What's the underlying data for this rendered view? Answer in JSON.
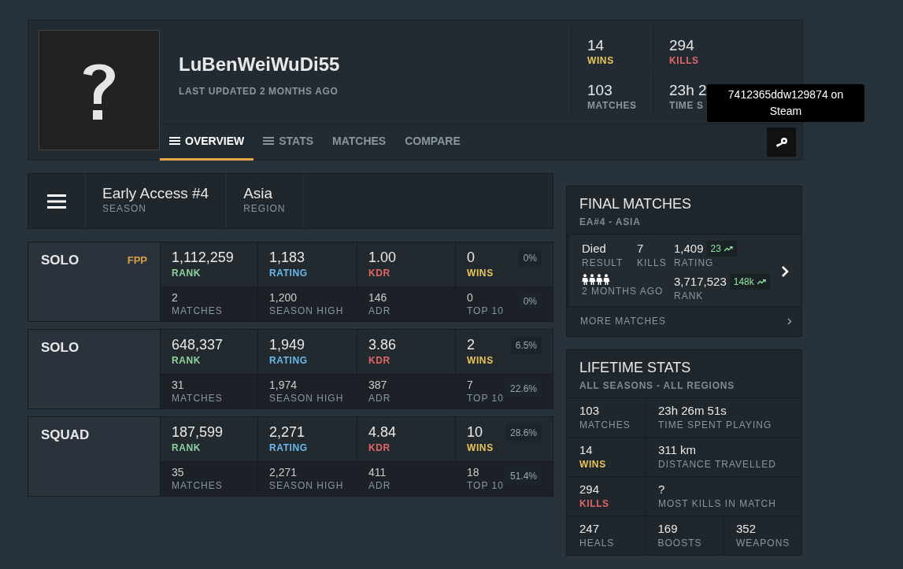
{
  "profile": {
    "name": "LuBenWeiWuDi55",
    "updated": "LAST UPDATED 2 MONTHS AGO"
  },
  "header_stats": [
    {
      "value": "14",
      "label": "WINS",
      "kind": "wins"
    },
    {
      "value": "294",
      "label": "KILLS",
      "kind": "kills"
    },
    {
      "value": "103",
      "label": "MATCHES",
      "kind": "plain"
    },
    {
      "value": "23h 2",
      "label": "TIME S",
      "kind": "plain"
    }
  ],
  "tabs": [
    {
      "label": "OVERVIEW",
      "selected": true,
      "menu_icon": true
    },
    {
      "label": "STATS",
      "selected": false,
      "menu_icon": true
    },
    {
      "label": "MATCHES",
      "selected": false,
      "menu_icon": false
    },
    {
      "label": "COMPARE",
      "selected": false,
      "menu_icon": false
    }
  ],
  "tooltip": "7412365ddw129874 on Steam",
  "season_bar": [
    {
      "value": "Early Access #4",
      "label": "SEASON"
    },
    {
      "value": "Asia",
      "label": "REGION"
    }
  ],
  "modes": [
    {
      "mode": "SOLO",
      "perspective": "FPP",
      "cells": [
        {
          "value": "1,112,259",
          "label": "RANK",
          "kind": "rank"
        },
        {
          "value": "1,183",
          "label": "RATING",
          "kind": "rating"
        },
        {
          "value": "1.00",
          "label": "KDR",
          "kind": "kdr"
        },
        {
          "value": "0",
          "label": "WINS",
          "kind": "wins",
          "percent": "0%"
        },
        {
          "value": "2",
          "label": "MATCHES",
          "kind": "plain"
        },
        {
          "value": "1,200",
          "label": "SEASON HIGH",
          "kind": "plain"
        },
        {
          "value": "146",
          "label": "ADR",
          "kind": "plain"
        },
        {
          "value": "0",
          "label": "TOP 10",
          "kind": "plain",
          "percent": "0%"
        }
      ]
    },
    {
      "mode": "SOLO",
      "cells": [
        {
          "value": "648,337",
          "label": "RANK",
          "kind": "rank"
        },
        {
          "value": "1,949",
          "label": "RATING",
          "kind": "rating"
        },
        {
          "value": "3.86",
          "label": "KDR",
          "kind": "kdr"
        },
        {
          "value": "2",
          "label": "WINS",
          "kind": "wins",
          "percent": "6.5%"
        },
        {
          "value": "31",
          "label": "MATCHES",
          "kind": "plain"
        },
        {
          "value": "1,974",
          "label": "SEASON HIGH",
          "kind": "plain"
        },
        {
          "value": "387",
          "label": "ADR",
          "kind": "plain"
        },
        {
          "value": "7",
          "label": "TOP 10",
          "kind": "plain",
          "percent": "22.6%"
        }
      ]
    },
    {
      "mode": "SQUAD",
      "cells": [
        {
          "value": "187,599",
          "label": "RANK",
          "kind": "rank"
        },
        {
          "value": "2,271",
          "label": "RATING",
          "kind": "rating"
        },
        {
          "value": "4.84",
          "label": "KDR",
          "kind": "kdr"
        },
        {
          "value": "10",
          "label": "WINS",
          "kind": "wins",
          "percent": "28.6%"
        },
        {
          "value": "35",
          "label": "MATCHES",
          "kind": "plain"
        },
        {
          "value": "2,271",
          "label": "SEASON HIGH",
          "kind": "plain"
        },
        {
          "value": "411",
          "label": "ADR",
          "kind": "plain"
        },
        {
          "value": "18",
          "label": "TOP 10",
          "kind": "plain",
          "percent": "51.4%"
        }
      ]
    }
  ],
  "final_matches": {
    "title": "FINAL MATCHES",
    "subtitle": "EA#4 - ASIA",
    "match": {
      "result": "Died",
      "result_label": "RESULT",
      "kills": "7",
      "kills_label": "KILLS",
      "rating": "1,409",
      "rating_delta": "23",
      "rating_label": "RATING",
      "when": "2 MONTHS AGO",
      "rank": "3,717,523",
      "rank_delta": "148k",
      "rank_label": "RANK"
    },
    "more": "MORE MATCHES"
  },
  "lifetime": {
    "title": "LIFETIME STATS",
    "subtitle": "ALL SEASONS - ALL REGIONS",
    "rows": [
      [
        {
          "value": "103",
          "label": "MATCHES",
          "kind": "plain"
        },
        {
          "value": "23h 26m 51s",
          "label": "TIME SPENT PLAYING",
          "kind": "plain"
        }
      ],
      [
        {
          "value": "14",
          "label": "WINS",
          "kind": "wins"
        },
        {
          "value": "311 km",
          "label": "DISTANCE TRAVELLED",
          "kind": "plain"
        }
      ],
      [
        {
          "value": "294",
          "label": "KILLS",
          "kind": "kills"
        },
        {
          "value": "?",
          "label": "MOST KILLS IN MATCH",
          "kind": "plain"
        }
      ],
      [
        {
          "value": "247",
          "label": "HEALS",
          "kind": "plain"
        },
        {
          "value": "169",
          "label": "BOOSTS",
          "kind": "plain"
        },
        {
          "value": "352",
          "label": "WEAPONS",
          "kind": "plain"
        }
      ]
    ]
  }
}
